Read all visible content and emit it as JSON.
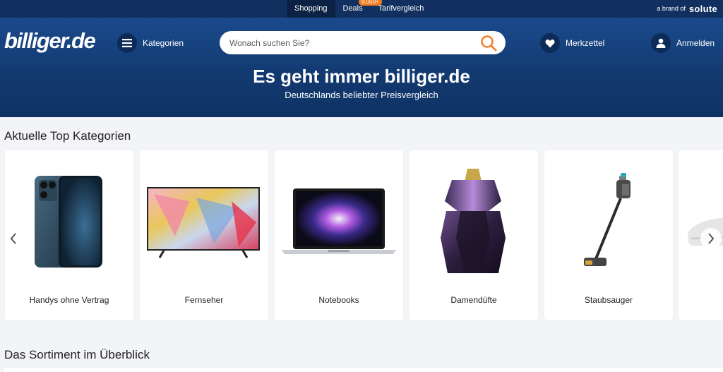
{
  "topbar": {
    "nav": [
      {
        "label": "Shopping"
      },
      {
        "label": "Deals"
      },
      {
        "label": "Tarifvergleich"
      }
    ],
    "deals_badge": "9.000+",
    "brand_prefix": "a brand of",
    "brand_name": "solute"
  },
  "header": {
    "logo": "billiger.de",
    "categories_label": "Kategorien",
    "search_placeholder": "Wonach suchen Sie?",
    "wishlist_label": "Merkzettel",
    "login_label": "Anmelden",
    "hero_title": "Es geht immer billiger.de",
    "hero_subtitle": "Deutschlands beliebter Preisvergleich"
  },
  "top_categories": {
    "title": "Aktuelle Top Kategorien",
    "items": [
      {
        "label": "Handys ohne Vertrag"
      },
      {
        "label": "Fernseher"
      },
      {
        "label": "Notebooks"
      },
      {
        "label": "Damendüfte"
      },
      {
        "label": "Staubsauger"
      }
    ]
  },
  "assortment": {
    "title": "Das Sortiment im Überblick"
  },
  "colors": {
    "topbar": "#12305f",
    "header": "#15407c",
    "accent": "#f47c20"
  }
}
